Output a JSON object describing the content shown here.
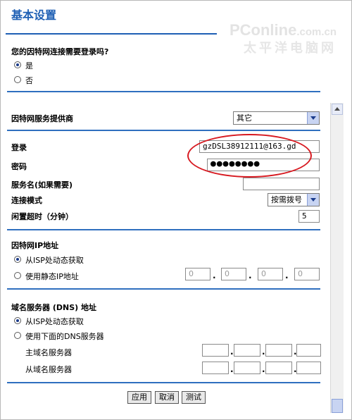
{
  "page": {
    "title": "基本设置"
  },
  "watermark": {
    "line1_main": "PConline",
    "line1_small": ".com.cn",
    "line2": "太平洋电脑网"
  },
  "login_required": {
    "question": "您的因特网连接需要登录吗?",
    "options": [
      {
        "label": "是",
        "selected": true
      },
      {
        "label": "否",
        "selected": false
      }
    ]
  },
  "isp": {
    "label": "因特网服务提供商",
    "selected": "其它"
  },
  "account": {
    "login_label": "登录",
    "login_value": "gzDSL38912111@163.gd",
    "password_label": "密码",
    "password_value": "●●●●●●●●",
    "service_label": "服务名(如果需要)",
    "service_value": "",
    "mode_label": "连接模式",
    "mode_value": "按需拨号",
    "idle_label": "闲置超时（分钟）",
    "idle_value": "5"
  },
  "wan_ip": {
    "label": "因特网IP地址",
    "options": [
      {
        "label": "从ISP处动态获取",
        "selected": true
      },
      {
        "label": "使用静态IP地址",
        "selected": false
      }
    ],
    "ip_parts": [
      "0",
      "0",
      "0",
      "0"
    ]
  },
  "dns": {
    "label": "域名服务器 (DNS) 地址",
    "options": [
      {
        "label": "从ISP处动态获取",
        "selected": true
      },
      {
        "label": "使用下面的DNS服务器",
        "selected": false
      }
    ],
    "primary_label": "主域名服务器",
    "secondary_label": "从域名服务器"
  },
  "buttons": {
    "apply": "应用",
    "cancel": "取消",
    "test": "测试"
  },
  "colors": {
    "accent": "#1e5fb4",
    "highlight": "#d71920"
  }
}
